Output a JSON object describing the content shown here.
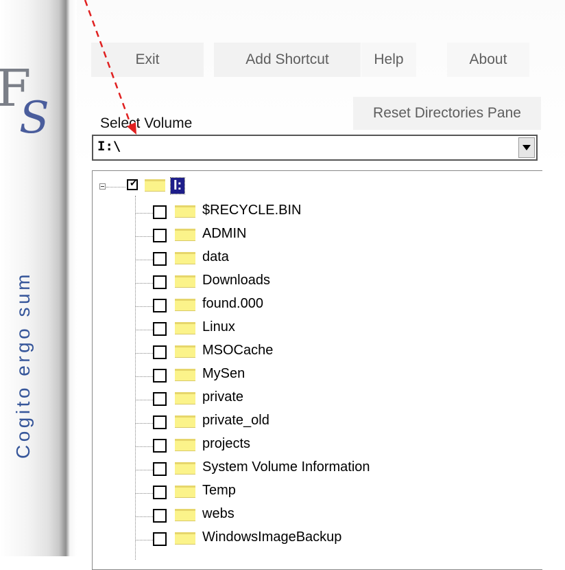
{
  "app": {
    "logo_text": "FS",
    "motto": "Cogito ergo sum"
  },
  "toolbar": {
    "exit_label": "Exit",
    "add_shortcut_label": "Add Shortcut",
    "help_label": "Help",
    "about_label": "About",
    "reset_label": "Reset Directories Pane"
  },
  "volume": {
    "label": "Select Volume",
    "value": "I:\\"
  },
  "tree": {
    "root": {
      "label": "I:",
      "checked": true
    },
    "items": [
      {
        "label": "$RECYCLE.BIN"
      },
      {
        "label": "ADMIN"
      },
      {
        "label": "data"
      },
      {
        "label": "Downloads"
      },
      {
        "label": "found.000"
      },
      {
        "label": "Linux"
      },
      {
        "label": "MSOCache"
      },
      {
        "label": "MySen"
      },
      {
        "label": "private"
      },
      {
        "label": "private_old"
      },
      {
        "label": "projects"
      },
      {
        "label": "System Volume Information"
      },
      {
        "label": "Temp"
      },
      {
        "label": "webs"
      },
      {
        "label": "WindowsImageBackup"
      }
    ]
  },
  "colors": {
    "accent_red": "#e02020",
    "selection_blue": "#1e1e8a",
    "folder_yellow": "#fbf38a",
    "motto_blue": "#36569a"
  }
}
